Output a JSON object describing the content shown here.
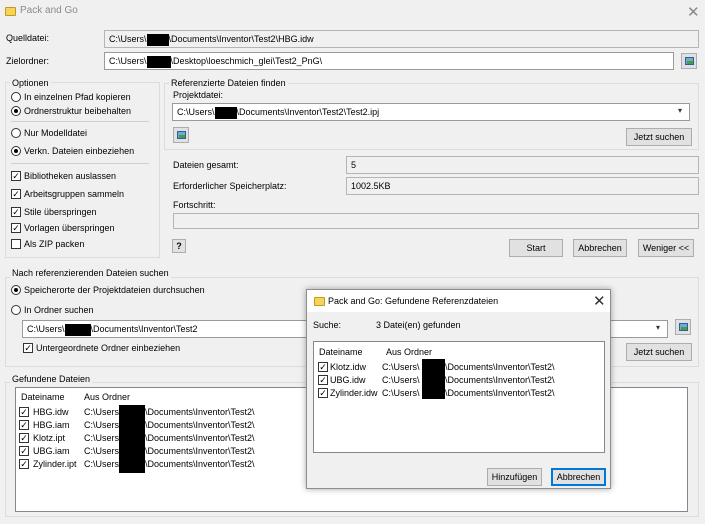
{
  "window": {
    "title": "Pack and Go",
    "close_glyph": "✕"
  },
  "source": {
    "label": "Quelldatei:",
    "value_pre": "C:\\Users\\",
    "value_post": "\\Documents\\Inventor\\Test2\\HBG.idw"
  },
  "target": {
    "label": "Zielordner:",
    "value_pre": "C:\\Users\\",
    "value_post": "\\Desktop\\loeschmich_glei\\Test2_PnG\\"
  },
  "options": {
    "title": "Optionen",
    "radio_copy_single": "In einzelnen Pfad kopieren",
    "radio_keep_structure": "Ordnerstruktur beibehalten",
    "radio_model_only": "Nur Modelldatei",
    "radio_include_linked": "Verkn. Dateien einbeziehen",
    "chk_exclude_libraries": "Bibliotheken auslassen",
    "chk_collect_workgroups": "Arbeitsgruppen sammeln",
    "chk_skip_styles": "Stile überspringen",
    "chk_skip_templates": "Vorlagen überspringen",
    "chk_zip": "Als ZIP packen"
  },
  "referenced": {
    "title": "Referenzierte Dateien finden",
    "project_label": "Projektdatei:",
    "project_pre": "C:\\Users\\",
    "project_post": "\\Documents\\Inventor\\Test2\\Test2.ipj",
    "search_now": "Jetzt suchen"
  },
  "stats": {
    "total_label": "Dateien gesamt:",
    "total_value": "5",
    "space_label": "Erforderlicher Speicherplatz:",
    "space_value": "1002.5KB",
    "progress_label": "Fortschritt:",
    "progress": 0
  },
  "actions": {
    "start": "Start",
    "cancel": "Abbrechen",
    "less": "Weniger <<",
    "help_glyph": "?"
  },
  "search_referencing": {
    "title": "Nach referenzierenden Dateien suchen",
    "radio_project_locations": "Speicherorte der Projektdateien durchsuchen",
    "radio_in_folder": "In Ordner suchen",
    "folder_pre": "C:\\Users\\",
    "folder_post": "\\Documents\\Inventor\\Test2",
    "chk_subfolders": "Untergeordnete Ordner einbeziehen",
    "search_now": "Jetzt suchen"
  },
  "found": {
    "title": "Gefundene Dateien",
    "col_filename": "Dateiname",
    "col_folder": "Aus Ordner",
    "rows": [
      {
        "name": "HBG.idw",
        "pre": "C:\\Users",
        "post": "\\Documents\\Inventor\\Test2\\"
      },
      {
        "name": "HBG.iam",
        "pre": "C:\\Users",
        "post": "\\Documents\\Inventor\\Test2\\"
      },
      {
        "name": "Klotz.ipt",
        "pre": "C:\\Users",
        "post": "\\Documents\\Inventor\\Test2\\"
      },
      {
        "name": "UBG.iam",
        "pre": "C:\\Users",
        "post": "\\Documents\\Inventor\\Test2\\"
      },
      {
        "name": "Zylinder.ipt",
        "pre": "C:\\Users",
        "post": "\\Documents\\Inventor\\Test2\\"
      }
    ]
  },
  "dialog": {
    "title": "Pack and Go: Gefundene Referenzdateien",
    "search_label": "Suche:",
    "search_result": "3 Datei(en) gefunden",
    "col_filename": "Dateiname",
    "col_folder": "Aus Ordner",
    "rows": [
      {
        "name": "Klotz.idw",
        "pre": "C:\\Users\\",
        "post": "\\Documents\\Inventor\\Test2\\"
      },
      {
        "name": "UBG.idw",
        "pre": "C:\\Users\\",
        "post": "\\Documents\\Inventor\\Test2\\"
      },
      {
        "name": "Zylinder.idw",
        "pre": "C:\\Users\\",
        "post": "\\Documents\\Inventor\\Test2\\"
      }
    ],
    "add": "Hinzufügen",
    "cancel": "Abbrechen",
    "close_glyph": "✕"
  },
  "glyphs": {
    "check": "✓",
    "combo_arrow": "▾"
  },
  "icons": [
    "folder-icon",
    "browse-image-icon",
    "help-icon",
    "close-icon",
    "chevron-down-icon"
  ]
}
